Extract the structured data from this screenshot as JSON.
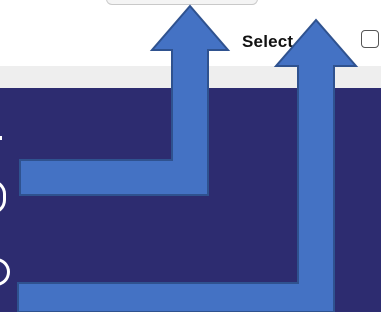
{
  "toolbar": {
    "select_all_label": "Select All",
    "select_all_checked": false
  },
  "colors": {
    "main_background": "#2d2c70",
    "arrow_fill": "#4472c4",
    "arrow_stroke": "#2f528f"
  },
  "icons": {
    "left_arrow": "arrow-up-icon",
    "right_arrow": "arrow-up-icon"
  }
}
